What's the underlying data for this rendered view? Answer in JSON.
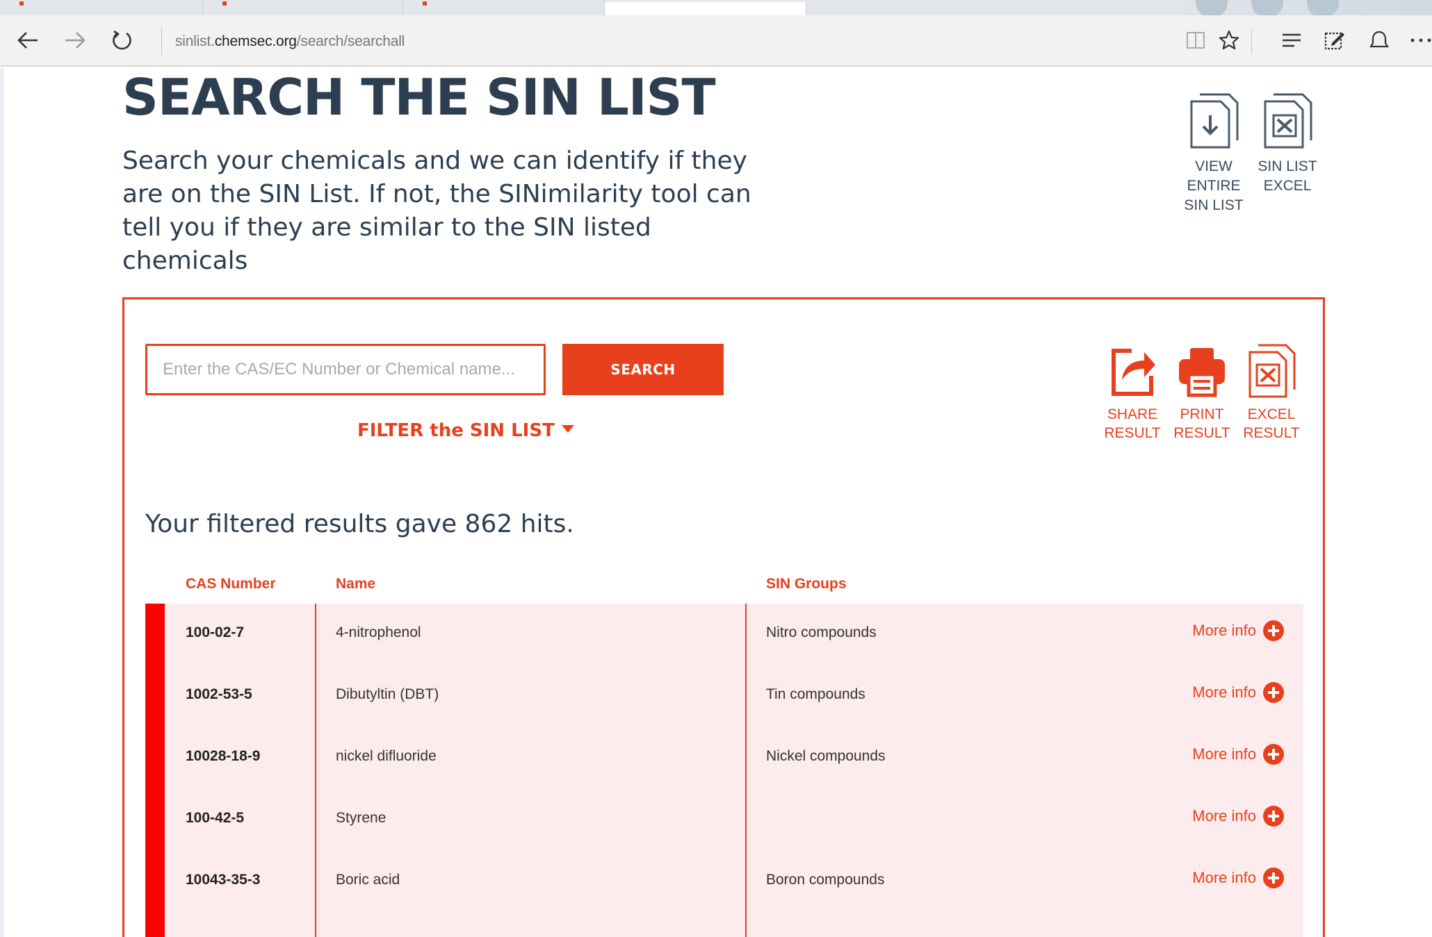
{
  "browser": {
    "url_prefix": "sinlist.",
    "url_domain": "chemsec.org",
    "url_path": "/search/searchall",
    "icons": [
      "back-arrow-icon",
      "forward-arrow-icon",
      "refresh-icon",
      "reading-view-icon",
      "favorite-star-icon",
      "hub-icon",
      "web-note-icon",
      "share-icon",
      "more-icon"
    ]
  },
  "page": {
    "title": "SEARCH THE SIN LIST",
    "intro": "Search your chemicals and we can identify if they are on the SIN List. If not, the SINimilarity tool can tell you if they are similar to the SIN listed chemicals",
    "view_list": {
      "line1": "VIEW",
      "line2": "ENTIRE",
      "line3": "SIN LIST"
    },
    "excel_list": {
      "line1": "SIN LIST",
      "line2": "EXCEL"
    }
  },
  "search": {
    "placeholder": "Enter the CAS/EC Number or Chemical name...",
    "button_label": "SEARCH",
    "filter_label": "FILTER the SIN LIST"
  },
  "results": {
    "share": {
      "line1": "SHARE",
      "line2": "RESULT"
    },
    "print": {
      "line1": "PRINT",
      "line2": "RESULT"
    },
    "excel": {
      "line1": "EXCEL",
      "line2": "RESULT"
    },
    "summary": "Your filtered results gave 862 hits.",
    "columns": {
      "cas": "CAS Number",
      "name": "Name",
      "groups": "SIN Groups"
    },
    "more_info_label": "More info",
    "rows": [
      {
        "cas": "100-02-7",
        "name": "4-nitrophenol",
        "group": "Nitro compounds"
      },
      {
        "cas": "1002-53-5",
        "name": "Dibutyltin (DBT)",
        "group": "Tin compounds"
      },
      {
        "cas": "10028-18-9",
        "name": "nickel difluoride",
        "group": "Nickel compounds"
      },
      {
        "cas": "100-42-5",
        "name": "Styrene",
        "group": ""
      },
      {
        "cas": "10043-35-3",
        "name": "Boric acid",
        "group": "Boron compounds"
      }
    ]
  },
  "colors": {
    "accent": "#e8401c",
    "heading": "#2c3e50",
    "row_bg": "#fdeced",
    "hazard_strip": "#ff0000"
  }
}
